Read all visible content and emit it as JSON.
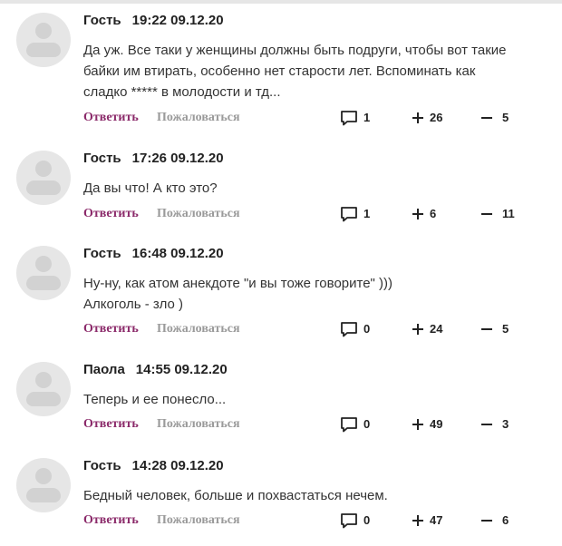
{
  "labels": {
    "reply": "Ответить",
    "report": "Пожаловаться"
  },
  "colors": {
    "reply_link": "#8b2a6a",
    "report_link": "#9a9a9a",
    "avatar_bg": "#e6e6e6"
  },
  "icons": [
    "comment-bubble-icon",
    "plus-icon",
    "minus-icon",
    "avatar-placeholder-icon"
  ],
  "comments": [
    {
      "author": "Гость",
      "time": "19:22 09.12.20",
      "text_lines": [
        "Да уж. Все таки у женщины должны быть подруги, чтобы вот такие",
        "байки им втирать, особенно нет старости лет. Вспоминать как",
        "сладко ***** в молодости и тд..."
      ],
      "replies": "1",
      "likes": "26",
      "dislikes": "5"
    },
    {
      "author": "Гость",
      "time": "17:26 09.12.20",
      "text_lines": [
        "Да вы что! А кто это?"
      ],
      "replies": "1",
      "likes": "6",
      "dislikes": "11"
    },
    {
      "author": "Гость",
      "time": "16:48 09.12.20",
      "text_lines": [
        "Ну-ну, как атом анекдоте \"и вы тоже говорите\" )))",
        "Алкоголь - зло )"
      ],
      "replies": "0",
      "likes": "24",
      "dislikes": "5"
    },
    {
      "author": "Паола",
      "time": "14:55 09.12.20",
      "text_lines": [
        "Теперь и ее понесло..."
      ],
      "replies": "0",
      "likes": "49",
      "dislikes": "3"
    },
    {
      "author": "Гость",
      "time": "14:28 09.12.20",
      "text_lines": [
        "Бедный человек, больше и похвастаться нечем."
      ],
      "replies": "0",
      "likes": "47",
      "dislikes": "6"
    }
  ]
}
